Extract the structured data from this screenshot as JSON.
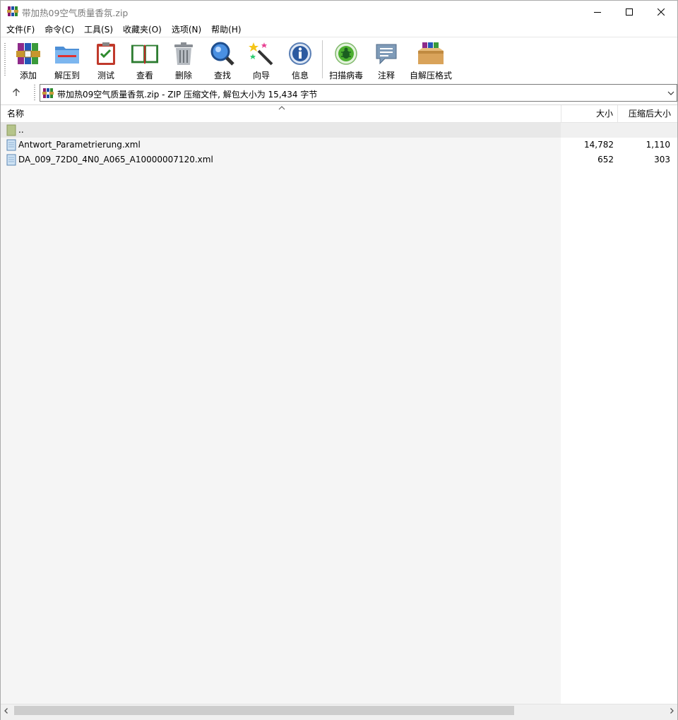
{
  "window": {
    "title": "带加热09空气质量香氛.zip",
    "minimize_icon": "minimize-icon",
    "maximize_icon": "maximize-icon",
    "close_icon": "close-icon"
  },
  "menu": [
    {
      "label": "文件(F)"
    },
    {
      "label": "命令(C)"
    },
    {
      "label": "工具(S)"
    },
    {
      "label": "收藏夹(O)"
    },
    {
      "label": "选项(N)"
    },
    {
      "label": "帮助(H)"
    }
  ],
  "toolbar": {
    "add": "添加",
    "extract": "解压到",
    "test": "测试",
    "view": "查看",
    "delete": "删除",
    "find": "查找",
    "wizard": "向导",
    "info": "信息",
    "virusscan": "扫描病毒",
    "comment": "注释",
    "sfx": "自解压格式"
  },
  "address": {
    "text": "带加热09空气质量香氛.zip - ZIP 压缩文件, 解包大小为 15,434 字节"
  },
  "columns": {
    "name": "名称",
    "size": "大小",
    "packed": "压缩后大小"
  },
  "files": [
    {
      "name": "..",
      "size": "",
      "packed": "",
      "type": "parent-folder"
    },
    {
      "name": "Antwort_Parametrierung.xml",
      "size": "14,782",
      "packed": "1,110",
      "type": "xml-file"
    },
    {
      "name": "DA_009_72D0_4N0_A065_A10000007120.xml",
      "size": "652",
      "packed": "303",
      "type": "xml-file"
    }
  ],
  "colors": {
    "list_bg": "#f5f5f5",
    "scroll_thumb": "#cdcdcd",
    "title_text": "#7a7a7a"
  }
}
